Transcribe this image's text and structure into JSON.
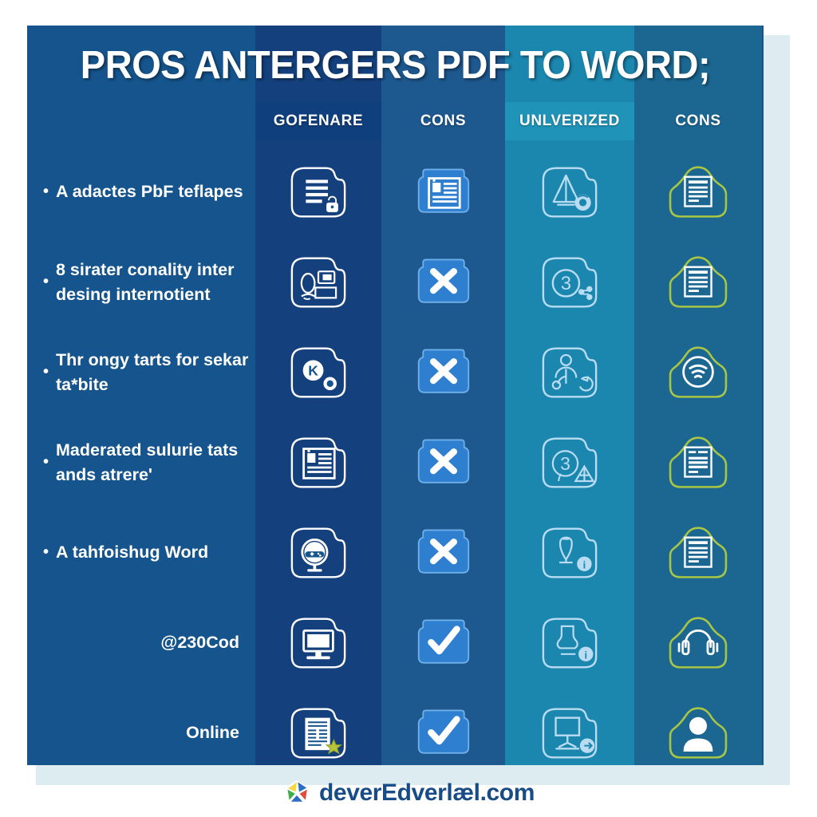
{
  "title": "PROS ANTERGERS PDF TO WORD;",
  "colors": {
    "panel_bg": "#15548c",
    "band_1": "#14407d",
    "band_2": "#1d588f",
    "band_3": "#1b86ae",
    "band_4": "#1b6792",
    "backing": "#dcecf1",
    "header_accent": "#1f93b8",
    "footer_text": "#174c86",
    "icon_outline_green": "#a8c543",
    "icon_outline_white": "#ffffff",
    "check_tile": "#2f7fd0"
  },
  "columns": [
    {
      "label": "GOFENARE"
    },
    {
      "label": "CONS"
    },
    {
      "label": "UNLVERIZED"
    },
    {
      "label": "CONS"
    }
  ],
  "rows": [
    {
      "bulleted": true,
      "text": "A adactes PbF teflapes",
      "cells": [
        {
          "icon": "document-lines-lock-icon",
          "style": "outline"
        },
        {
          "icon": "news-layout-icon",
          "style": "tile"
        },
        {
          "icon": "triangle-arrow-sync-icon",
          "style": "outline-light"
        },
        {
          "icon": "document-text-icon",
          "style": "outline-green"
        }
      ]
    },
    {
      "bulleted": true,
      "text": "8 sirater conality inter desing internotient",
      "cells": [
        {
          "icon": "person-presentation-icon",
          "style": "outline"
        },
        {
          "icon": "cross-x-icon",
          "style": "tile"
        },
        {
          "icon": "number-three-share-icon",
          "style": "outline-light"
        },
        {
          "icon": "document-text-icon",
          "style": "outline-green"
        }
      ]
    },
    {
      "bulleted": true,
      "text": "Thr ongy tarts for sekar ta*bite",
      "cells": [
        {
          "icon": "k-circle-badge-icon",
          "style": "outline"
        },
        {
          "icon": "cross-x-icon",
          "style": "tile"
        },
        {
          "icon": "person-refresh-icon",
          "style": "outline-light"
        },
        {
          "icon": "wifi-circle-icon",
          "style": "outline-green"
        }
      ]
    },
    {
      "bulleted": true,
      "text": "Maderated sulurie tats ands atrereʹ",
      "cells": [
        {
          "icon": "news-layout-icon",
          "style": "outline"
        },
        {
          "icon": "cross-x-icon",
          "style": "tile"
        },
        {
          "icon": "number-three-upload-icon",
          "style": "outline-light"
        },
        {
          "icon": "document-form-icon",
          "style": "outline-green"
        }
      ]
    },
    {
      "bulleted": true,
      "text": "A tahfoishug Word",
      "cells": [
        {
          "icon": "gamepad-globe-icon",
          "style": "outline"
        },
        {
          "icon": "cross-x-icon",
          "style": "tile"
        },
        {
          "icon": "lamp-info-icon",
          "style": "outline-light"
        },
        {
          "icon": "document-text-icon",
          "style": "outline-green"
        }
      ]
    },
    {
      "bulleted": false,
      "text": "@230Cod",
      "cells": [
        {
          "icon": "monitor-screen-icon",
          "style": "outline"
        },
        {
          "icon": "check-mark-icon",
          "style": "tile"
        },
        {
          "icon": "flask-info-icon",
          "style": "outline-light"
        },
        {
          "icon": "headphones-support-icon",
          "style": "outline-green"
        }
      ]
    },
    {
      "bulleted": false,
      "text": "Online",
      "cells": [
        {
          "icon": "invoice-star-icon",
          "style": "outline"
        },
        {
          "icon": "check-mark-icon",
          "style": "tile"
        },
        {
          "icon": "presentation-board-icon",
          "style": "outline-light"
        },
        {
          "icon": "user-avatar-icon",
          "style": "outline-green"
        }
      ]
    }
  ],
  "footer": {
    "brand": "deverEdverlæl.com",
    "logo": "pinwheel-logo-icon"
  }
}
